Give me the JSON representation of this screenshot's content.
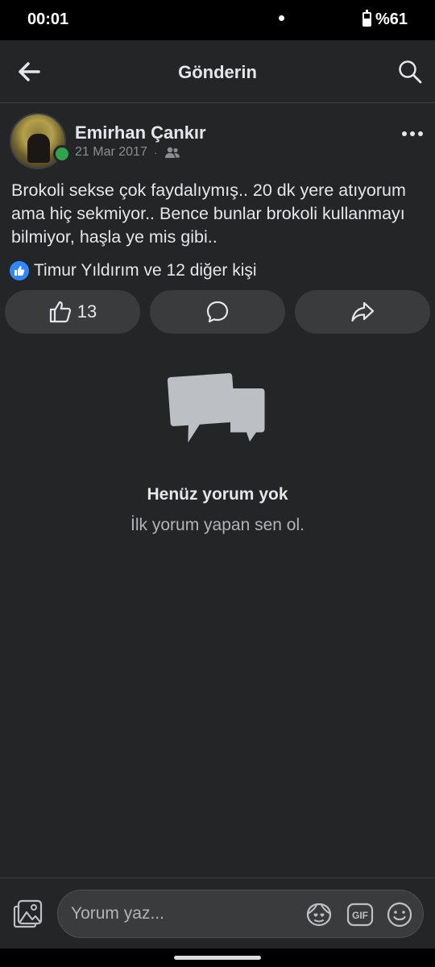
{
  "status": {
    "time": "00:01",
    "battery": "%61"
  },
  "header": {
    "title": "Gönderin"
  },
  "post": {
    "author": "Emirhan Çankır",
    "date": "21 Mar 2017",
    "separator": "·",
    "text": "Brokoli sekse çok faydalıymış.. 20 dk yere atıyorum ama hiç sekmiyor.. Bence bunlar brokoli kullanmayı bilmiyor, haşla ye mis gibi..",
    "reactions_text": "Timur Yıldırım ve 12 diğer kişi",
    "like_count": "13"
  },
  "comments": {
    "empty_title": "Henüz yorum yok",
    "empty_subtitle": "İlk yorum yapan sen ol."
  },
  "composer": {
    "placeholder": "Yorum yaz..."
  },
  "icons": {
    "back": "arrow-left-icon",
    "search": "search-icon",
    "more": "more-dots-icon",
    "audience": "friends-icon",
    "like": "thumbs-up-icon",
    "comment": "comment-bubble-icon",
    "share": "share-arrow-icon",
    "photo": "photo-icon",
    "sticker": "sticker-icon",
    "gif": "gif-icon",
    "emoji": "emoji-icon"
  },
  "colors": {
    "background": "#242526",
    "accent": "#2e89ff",
    "online": "#31a24c"
  }
}
